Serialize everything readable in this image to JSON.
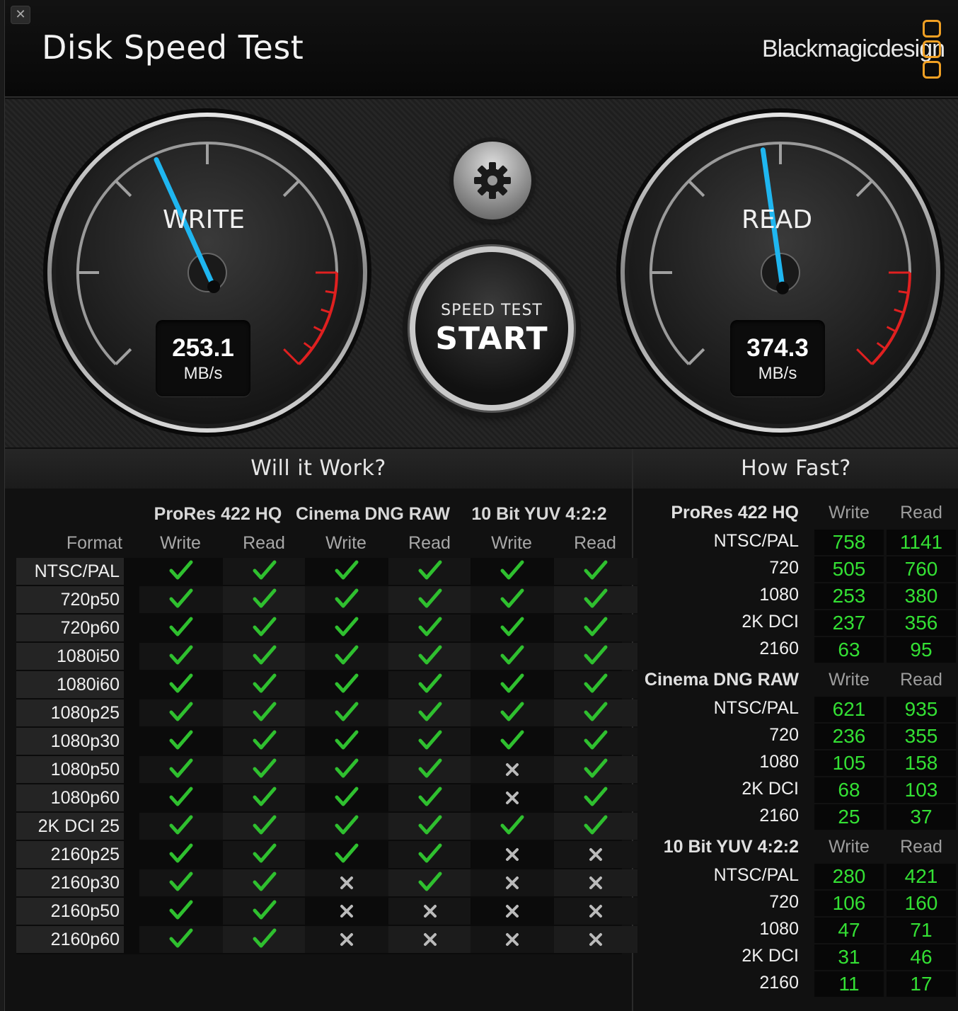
{
  "window": {
    "title": "Disk Speed Test",
    "brand": "Blackmagicdesign",
    "close_glyph": "✕"
  },
  "gauges": {
    "write": {
      "label": "WRITE",
      "value": "253.1",
      "unit": "MB/s",
      "needle_fraction": 0.41
    },
    "read": {
      "label": "READ",
      "value": "374.3",
      "unit": "MB/s",
      "needle_fraction": 0.47
    },
    "colors": {
      "needle": "#1fb6f0",
      "redline": "#e02020"
    }
  },
  "start_button": {
    "small": "SPEED TEST",
    "big": "START"
  },
  "settings": {
    "icon": "gear-icon"
  },
  "will_it_work": {
    "title": "Will it Work?",
    "format_label": "Format",
    "codecs": [
      "ProRes 422 HQ",
      "Cinema DNG RAW",
      "10 Bit YUV 4:2:2"
    ],
    "col_labels": [
      "Write",
      "Read",
      "Write",
      "Read",
      "Write",
      "Read"
    ],
    "rows": [
      {
        "format": "NTSC/PAL",
        "results": [
          1,
          1,
          1,
          1,
          1,
          1
        ]
      },
      {
        "format": "720p50",
        "results": [
          1,
          1,
          1,
          1,
          1,
          1
        ]
      },
      {
        "format": "720p60",
        "results": [
          1,
          1,
          1,
          1,
          1,
          1
        ]
      },
      {
        "format": "1080i50",
        "results": [
          1,
          1,
          1,
          1,
          1,
          1
        ]
      },
      {
        "format": "1080i60",
        "results": [
          1,
          1,
          1,
          1,
          1,
          1
        ]
      },
      {
        "format": "1080p25",
        "results": [
          1,
          1,
          1,
          1,
          1,
          1
        ]
      },
      {
        "format": "1080p30",
        "results": [
          1,
          1,
          1,
          1,
          1,
          1
        ]
      },
      {
        "format": "1080p50",
        "results": [
          1,
          1,
          1,
          1,
          0,
          1
        ]
      },
      {
        "format": "1080p60",
        "results": [
          1,
          1,
          1,
          1,
          0,
          1
        ]
      },
      {
        "format": "2K DCI 25",
        "results": [
          1,
          1,
          1,
          1,
          1,
          1
        ]
      },
      {
        "format": "2160p25",
        "results": [
          1,
          1,
          1,
          1,
          0,
          0
        ]
      },
      {
        "format": "2160p30",
        "results": [
          1,
          1,
          0,
          1,
          0,
          0
        ]
      },
      {
        "format": "2160p50",
        "results": [
          1,
          1,
          0,
          0,
          0,
          0
        ]
      },
      {
        "format": "2160p60",
        "results": [
          1,
          1,
          0,
          0,
          0,
          0
        ]
      }
    ],
    "icons": {
      "pass": "checkmark-icon",
      "fail": "cross-icon"
    },
    "colors": {
      "pass": "#2fc02f",
      "fail": "#bbbbbb"
    }
  },
  "how_fast": {
    "title": "How Fast?",
    "write_label": "Write",
    "read_label": "Read",
    "groups": [
      {
        "codec": "ProRes 422 HQ",
        "rows": [
          {
            "format": "NTSC/PAL",
            "write": "758",
            "read": "1141"
          },
          {
            "format": "720",
            "write": "505",
            "read": "760"
          },
          {
            "format": "1080",
            "write": "253",
            "read": "380"
          },
          {
            "format": "2K DCI",
            "write": "237",
            "read": "356"
          },
          {
            "format": "2160",
            "write": "63",
            "read": "95"
          }
        ]
      },
      {
        "codec": "Cinema DNG RAW",
        "rows": [
          {
            "format": "NTSC/PAL",
            "write": "621",
            "read": "935"
          },
          {
            "format": "720",
            "write": "236",
            "read": "355"
          },
          {
            "format": "1080",
            "write": "105",
            "read": "158"
          },
          {
            "format": "2K DCI",
            "write": "68",
            "read": "103"
          },
          {
            "format": "2160",
            "write": "25",
            "read": "37"
          }
        ]
      },
      {
        "codec": "10 Bit YUV 4:2:2",
        "rows": [
          {
            "format": "NTSC/PAL",
            "write": "280",
            "read": "421"
          },
          {
            "format": "720",
            "write": "106",
            "read": "160"
          },
          {
            "format": "1080",
            "write": "47",
            "read": "71"
          },
          {
            "format": "2K DCI",
            "write": "31",
            "read": "46"
          },
          {
            "format": "2160",
            "write": "11",
            "read": "17"
          }
        ]
      }
    ]
  }
}
